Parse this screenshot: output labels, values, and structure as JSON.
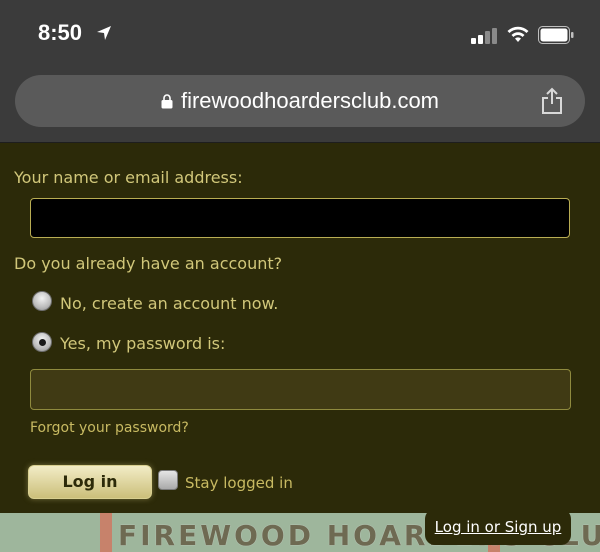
{
  "status_bar": {
    "time": "8:50",
    "icons": [
      "location-arrow-icon",
      "signal-icon",
      "wifi-icon",
      "battery-icon"
    ]
  },
  "browser": {
    "url": "firewoodhoardersclub.com",
    "icons": [
      "lock-icon",
      "share-icon"
    ]
  },
  "login_form": {
    "name_label": "Your name or email address:",
    "name_value": "",
    "account_question": "Do you already have an account?",
    "options": [
      {
        "label": "No, create an account now.",
        "selected": false
      },
      {
        "label": "Yes, my password is:",
        "selected": true
      }
    ],
    "password_value": "",
    "forgot_link": "Forgot your password?",
    "login_button": "Log in",
    "stay_logged_in": "Stay logged in",
    "stay_logged_in_checked": false
  },
  "site_header": {
    "banner_text": "FIREWOOD HOARDERS CLUB",
    "login_signup": "Log in or Sign up"
  },
  "colors": {
    "page_bg": "#2c2a09",
    "label_text": "#d1c77a",
    "chrome_bg": "#3b3b3b"
  }
}
